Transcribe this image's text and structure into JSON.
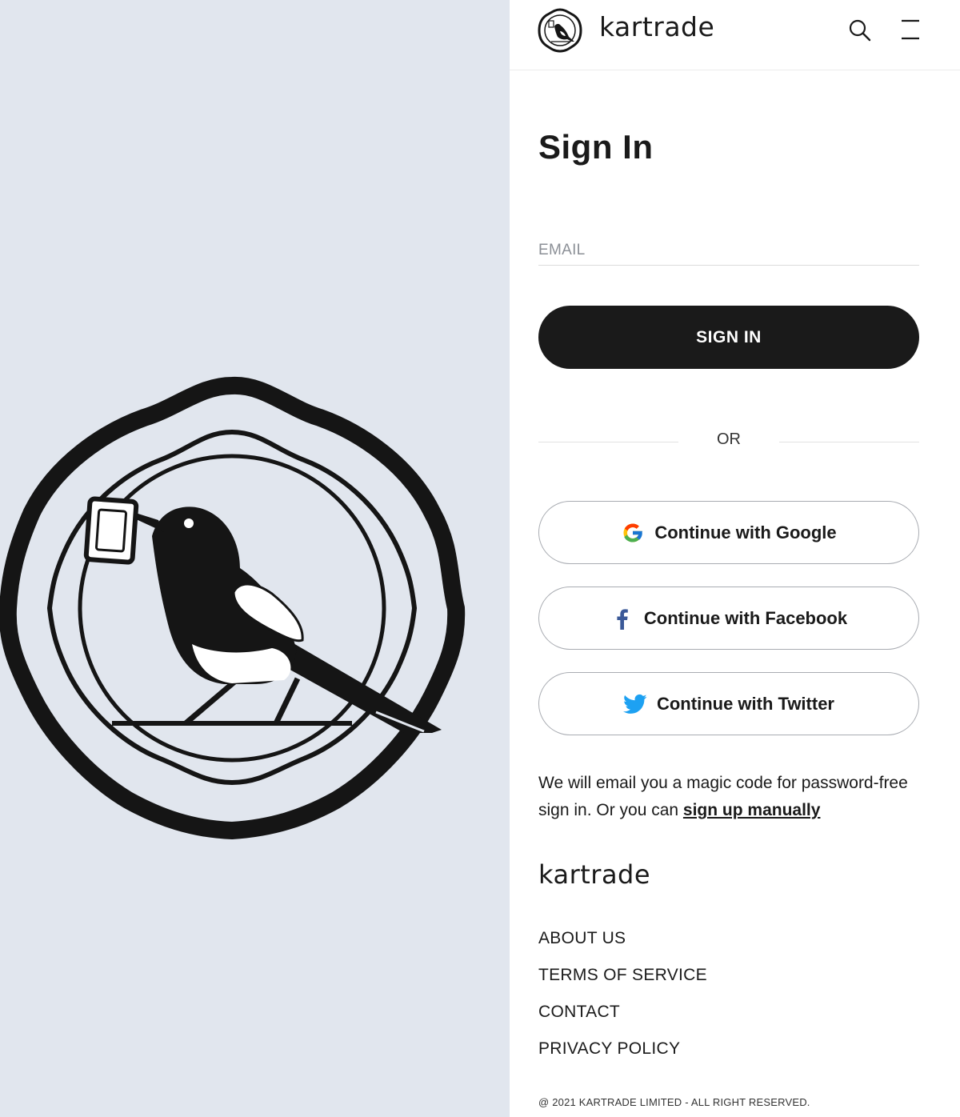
{
  "header": {
    "brand_name": "kartrade",
    "search_icon": "search-icon",
    "menu_icon": "menu-icon"
  },
  "signin": {
    "title": "Sign In",
    "email_placeholder": "EMAIL",
    "email_value": "",
    "submit_label": "SIGN IN",
    "or_label": "OR"
  },
  "social": [
    {
      "label": "Continue with Google",
      "icon": "google-icon"
    },
    {
      "label": "Continue with Facebook",
      "icon": "facebook-icon"
    },
    {
      "label": "Continue with Twitter",
      "icon": "twitter-icon"
    }
  ],
  "notice": {
    "text": "We will email you a magic code for password-free sign in. Or you can ",
    "link_label": "sign up manually"
  },
  "footer": {
    "brand_name": "kartrade",
    "links": [
      "ABOUT US",
      "TERMS OF SERVICE",
      "CONTACT",
      "PRIVACY POLICY"
    ],
    "copyright": "@ 2021 KARTRADE LIMITED - ALL RIGHT RESERVED."
  },
  "colors": {
    "left_panel_bg": "#e1e6ee",
    "primary": "#1a1a1a",
    "facebook": "#3b5998",
    "twitter": "#1da1f2"
  }
}
